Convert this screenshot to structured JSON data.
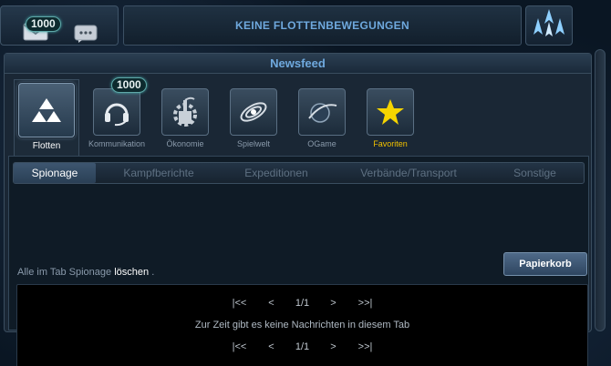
{
  "topbar": {
    "mail_count": "1000",
    "fleet_status": "KEINE FLOTTENBEWEGUNGEN"
  },
  "panel": {
    "title": "Newsfeed"
  },
  "categories": [
    {
      "label": "Flotten",
      "icon": "fleet-icon"
    },
    {
      "label": "Kommunikation",
      "icon": "headset-icon",
      "badge": "1000"
    },
    {
      "label": "Ökonomie",
      "icon": "economy-icon"
    },
    {
      "label": "Spielwelt",
      "icon": "galaxy-icon"
    },
    {
      "label": "OGame",
      "icon": "ogame-planet-icon"
    },
    {
      "label": "Favoriten",
      "icon": "star-icon"
    }
  ],
  "subtabs": [
    {
      "label": "Spionage"
    },
    {
      "label": "Kampfberichte"
    },
    {
      "label": "Expeditionen"
    },
    {
      "label": "Verbände/Transport"
    },
    {
      "label": "Sonstige"
    }
  ],
  "delete_line": {
    "prefix": "Alle im Tab Spionage",
    "link": "löschen",
    "suffix": "."
  },
  "trash_button": "Papierkorb",
  "pager": {
    "first": "|<<",
    "prev": "<",
    "page": "1/1",
    "next": ">",
    "last": ">>|"
  },
  "empty_message": "Zur Zeit gibt es keine Nachrichten in diesem Tab",
  "colors": {
    "accent_blue": "#6fa9de",
    "favorites_gold": "#f0c000"
  }
}
